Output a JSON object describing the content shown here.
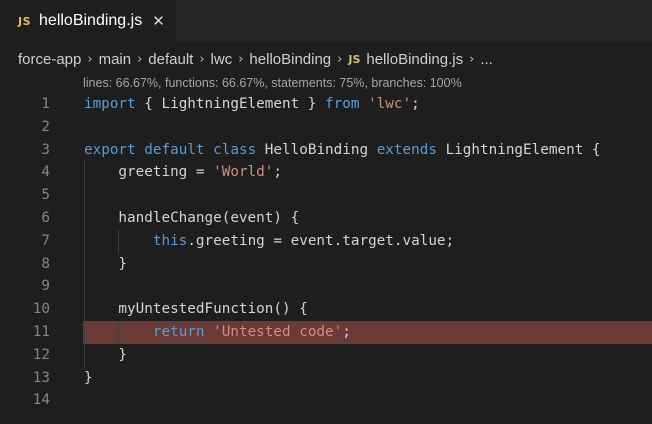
{
  "tab": {
    "badge": "JS",
    "title": "helloBinding.js",
    "close_glyph": "✕"
  },
  "breadcrumbs": {
    "items": [
      "force-app",
      "main",
      "default",
      "lwc",
      "helloBinding"
    ],
    "file_badge": "JS",
    "file": "helloBinding.js",
    "more": "...",
    "separator": "›"
  },
  "coverage": "lines: 66.67%, functions: 66.67%, statements: 75%, branches: 100%",
  "code": {
    "lines": [
      {
        "num": "1",
        "parts": [
          [
            "kw",
            "import"
          ],
          [
            "plain",
            " { LightningElement } "
          ],
          [
            "kw",
            "from"
          ],
          [
            "plain",
            " "
          ],
          [
            "str",
            "'lwc'"
          ],
          [
            "plain",
            ";"
          ]
        ]
      },
      {
        "num": "2",
        "parts": []
      },
      {
        "num": "3",
        "parts": [
          [
            "kw",
            "export"
          ],
          [
            "plain",
            " "
          ],
          [
            "kw",
            "default"
          ],
          [
            "plain",
            " "
          ],
          [
            "kw",
            "class"
          ],
          [
            "plain",
            " HelloBinding "
          ],
          [
            "kw",
            "extends"
          ],
          [
            "plain",
            " LightningElement {"
          ]
        ]
      },
      {
        "num": "4",
        "parts": [
          [
            "plain",
            "    greeting = "
          ],
          [
            "str",
            "'World'"
          ],
          [
            "plain",
            ";"
          ]
        ]
      },
      {
        "num": "5",
        "parts": []
      },
      {
        "num": "6",
        "parts": [
          [
            "plain",
            "    handleChange(event) {"
          ]
        ]
      },
      {
        "num": "7",
        "parts": [
          [
            "plain",
            "        "
          ],
          [
            "kw",
            "this"
          ],
          [
            "plain",
            ".greeting = event.target.value;"
          ]
        ]
      },
      {
        "num": "8",
        "parts": [
          [
            "plain",
            "    }"
          ]
        ]
      },
      {
        "num": "9",
        "parts": []
      },
      {
        "num": "10",
        "parts": [
          [
            "plain",
            "    myUntestedFunction() {"
          ]
        ]
      },
      {
        "num": "11",
        "parts": [
          [
            "plain",
            "        "
          ],
          [
            "kw",
            "return"
          ],
          [
            "plain",
            " "
          ],
          [
            "str",
            "'Untested code'"
          ],
          [
            "plain",
            ";"
          ]
        ],
        "uncovered": true
      },
      {
        "num": "12",
        "parts": [
          [
            "plain",
            "    }"
          ]
        ]
      },
      {
        "num": "13",
        "parts": [
          [
            "plain",
            "}"
          ]
        ]
      },
      {
        "num": "14",
        "parts": []
      }
    ]
  },
  "colors": {
    "keyword": "#569cd6",
    "string": "#ce9178",
    "uncovered_bg": "#6a3a37",
    "editor_bg": "#1e1e1e",
    "js_badge": "#d8c25b"
  }
}
